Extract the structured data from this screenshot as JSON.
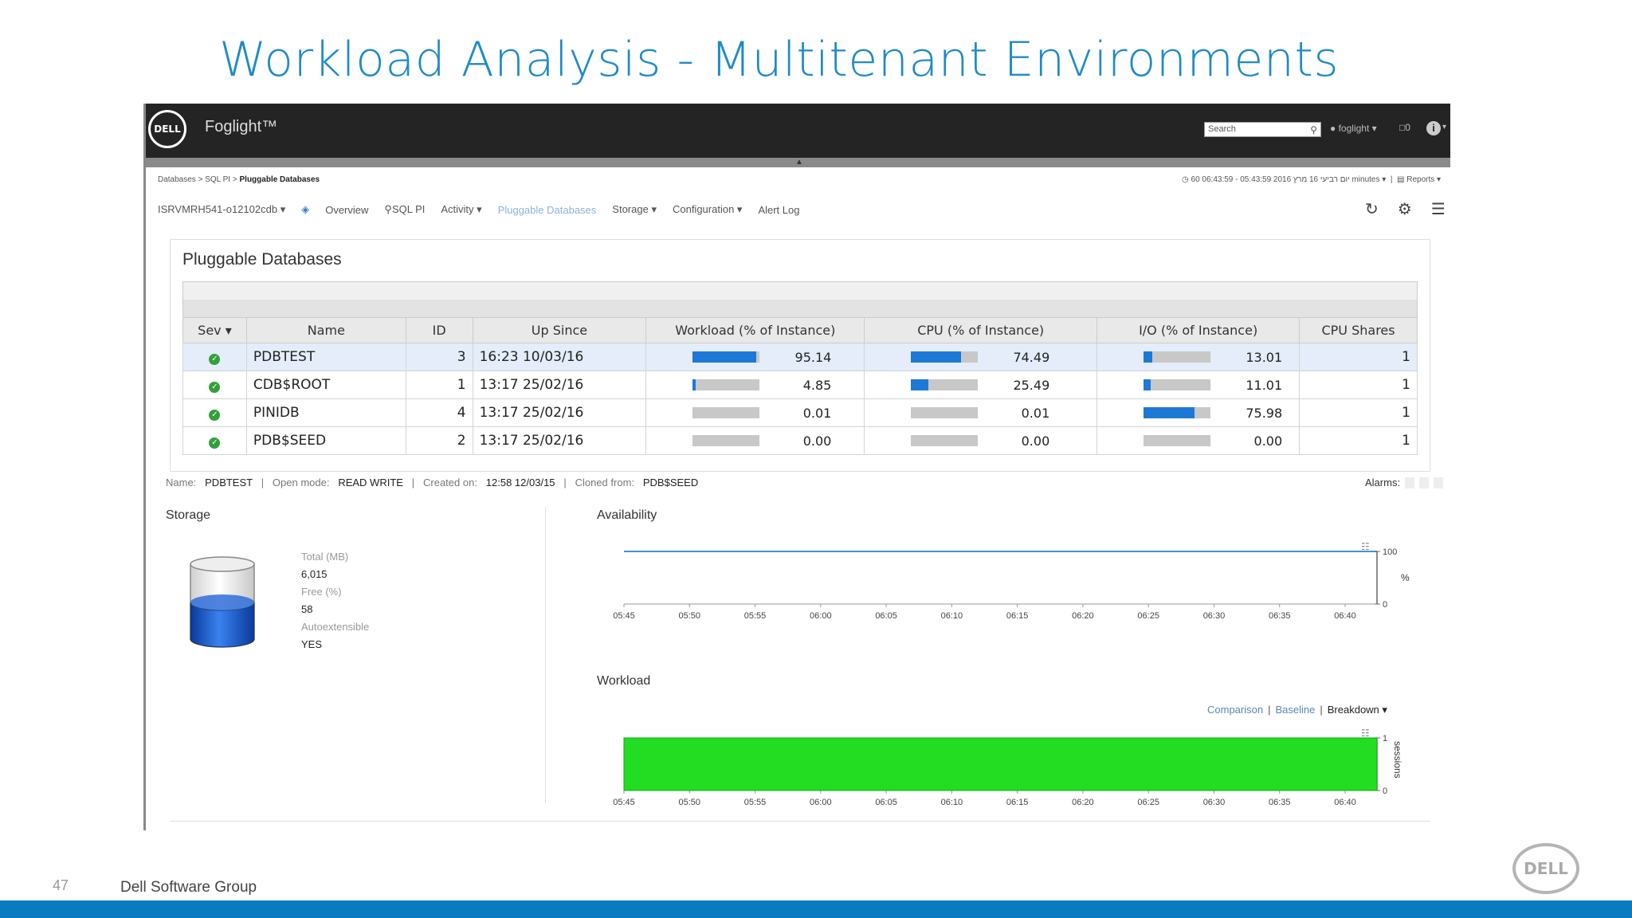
{
  "slide": {
    "title": "Workload Analysis - Multitenant Environments",
    "page_number": "47",
    "footer_text": "Dell Software Group",
    "logo_text": "DELL",
    "accent_color": "#1f8bc4",
    "footer_bar_color": "#0b7bc1"
  },
  "app": {
    "logo_text": "DELL",
    "name": "Foglight™",
    "search_placeholder": "Search",
    "user": "foglight",
    "messages": "0"
  },
  "breadcrumb": {
    "root": "Databases",
    "mid": "SQL PI",
    "current": "Pluggable Databases",
    "timerange": "60 06:43:59 - 05:43:59 2016 יום רביעי 16 מרץ minutes",
    "reports": "Reports"
  },
  "nav": {
    "instance": "ISRVMRH541-o12102cdb",
    "items": [
      "Overview",
      "SQL PI",
      "Activity",
      "Pluggable Databases",
      "Storage",
      "Configuration",
      "Alert Log"
    ]
  },
  "panel": {
    "title": "Pluggable Databases",
    "columns": [
      "Sev",
      "Name",
      "ID",
      "Up Since",
      "Workload (% of Instance)",
      "CPU (% of Instance)",
      "I/O (% of Instance)",
      "CPU Shares"
    ],
    "rows": [
      {
        "name": "PDBTEST",
        "id": "3",
        "up_since": "16:23 10/03/16",
        "workload": 95.14,
        "workload_txt": "95.14",
        "cpu": 74.49,
        "cpu_txt": "74.49",
        "io": 13.01,
        "io_txt": "13.01",
        "shares": "1"
      },
      {
        "name": "CDB$ROOT",
        "id": "1",
        "up_since": "13:17 25/02/16",
        "workload": 4.85,
        "workload_txt": "4.85",
        "cpu": 25.49,
        "cpu_txt": "25.49",
        "io": 11.01,
        "io_txt": "11.01",
        "shares": "1"
      },
      {
        "name": "PINIDB",
        "id": "4",
        "up_since": "13:17 25/02/16",
        "workload": 0.01,
        "workload_txt": "0.01",
        "cpu": 0.01,
        "cpu_txt": "0.01",
        "io": 75.98,
        "io_txt": "75.98",
        "shares": "1"
      },
      {
        "name": "PDB$SEED",
        "id": "2",
        "up_since": "13:17 25/02/16",
        "workload": 0.0,
        "workload_txt": "0.00",
        "cpu": 0.0,
        "cpu_txt": "0.00",
        "io": 0.0,
        "io_txt": "0.00",
        "shares": "1"
      }
    ]
  },
  "detail": {
    "name_label": "Name:",
    "name": "PDBTEST",
    "mode_label": "Open mode:",
    "mode": "READ WRITE",
    "created_label": "Created on:",
    "created": "12:58 12/03/15",
    "cloned_label": "Cloned from:",
    "cloned": "PDB$SEED",
    "alarms_label": "Alarms:"
  },
  "storage": {
    "title": "Storage",
    "total_label": "Total (MB)",
    "total": "6,015",
    "free_label": "Free (%)",
    "free": "58",
    "auto_label": "Autoextensible",
    "auto": "YES"
  },
  "availability": {
    "title": "Availability",
    "unit": "%",
    "y_top": "100",
    "y_bottom": "0"
  },
  "workload": {
    "title": "Workload",
    "comparison": "Comparison",
    "baseline": "Baseline",
    "breakdown": "Breakdown",
    "unit": "sessions",
    "y_top": "1",
    "y_bottom": "0"
  },
  "chart_data": [
    {
      "type": "line",
      "title": "Availability",
      "ylabel": "%",
      "x": [
        "05:45",
        "05:50",
        "05:55",
        "06:00",
        "06:05",
        "06:10",
        "06:15",
        "06:20",
        "06:25",
        "06:30",
        "06:35",
        "06:40"
      ],
      "series": [
        {
          "values": [
            100,
            100,
            100,
            100,
            100,
            100,
            100,
            100,
            100,
            100,
            100,
            100
          ]
        }
      ],
      "ylim": [
        0,
        100
      ],
      "color": "#4a90d9"
    },
    {
      "type": "area",
      "title": "Workload",
      "ylabel": "sessions",
      "x": [
        "05:45",
        "05:50",
        "05:55",
        "06:00",
        "06:05",
        "06:10",
        "06:15",
        "06:20",
        "06:25",
        "06:30",
        "06:35",
        "06:40"
      ],
      "series": [
        {
          "values": [
            1,
            1,
            1,
            1,
            1,
            1,
            1,
            1,
            1,
            1,
            1,
            1
          ]
        }
      ],
      "ylim": [
        0,
        1
      ],
      "color": "#22dd22"
    }
  ]
}
